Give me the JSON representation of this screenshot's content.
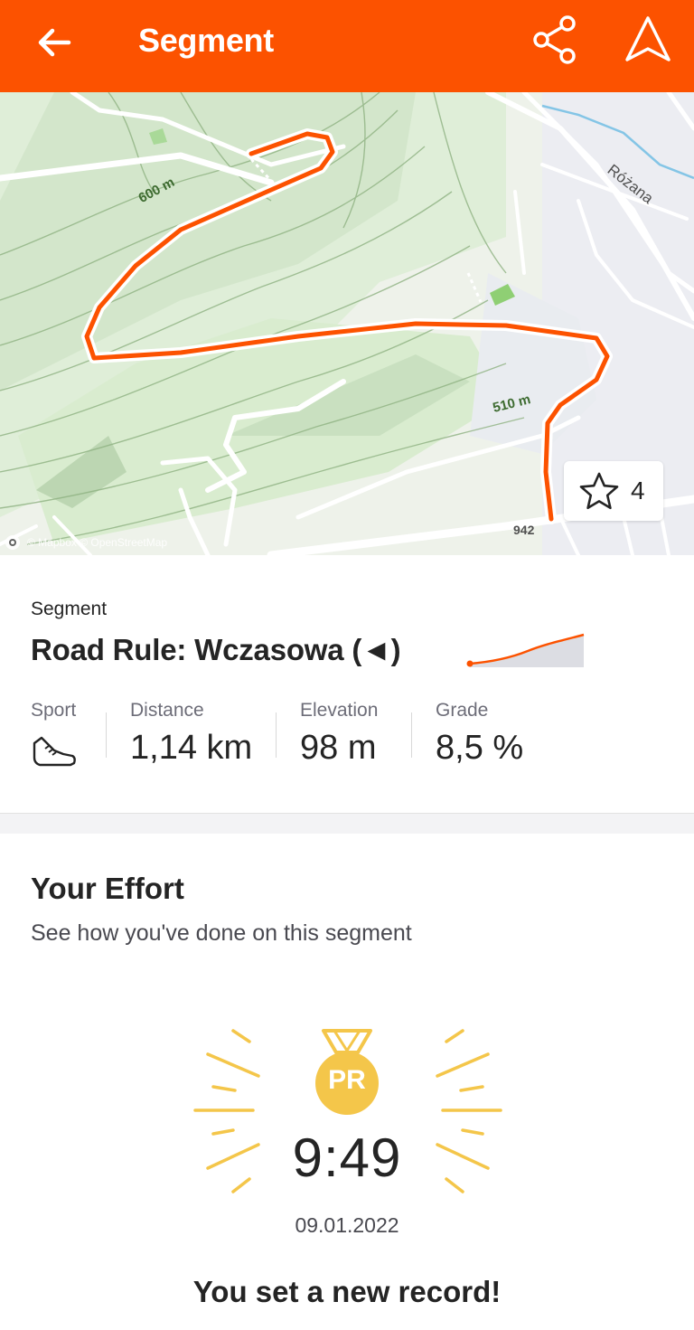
{
  "header": {
    "title": "Segment",
    "back_icon": "arrow-left-icon",
    "share_icon": "share-icon",
    "navigate_icon": "navigation-arrow-icon",
    "color": "#fc5200"
  },
  "map": {
    "contour_labels": [
      "600 m",
      "510 m"
    ],
    "street_label": "Różana",
    "road_number": "942",
    "attribution": "© Mapbox © OpenStreetMap",
    "route_color": "#fc5200",
    "star_count": "4"
  },
  "segment": {
    "kicker": "Segment",
    "name": "Road Rule: Wczasowa (◄)",
    "stats": [
      {
        "label": "Sport",
        "value": "",
        "icon": "running-shoe-icon"
      },
      {
        "label": "Distance",
        "value": "1,14 km"
      },
      {
        "label": "Elevation",
        "value": "98 m"
      },
      {
        "label": "Grade",
        "value": "8,5 %"
      }
    ]
  },
  "effort": {
    "title": "Your Effort",
    "subtitle": "See how you've done on this segment",
    "badge": "PR",
    "time": "9:49",
    "date": "09.01.2022",
    "message": "You set a new record!",
    "accent": "#f4c64a"
  }
}
